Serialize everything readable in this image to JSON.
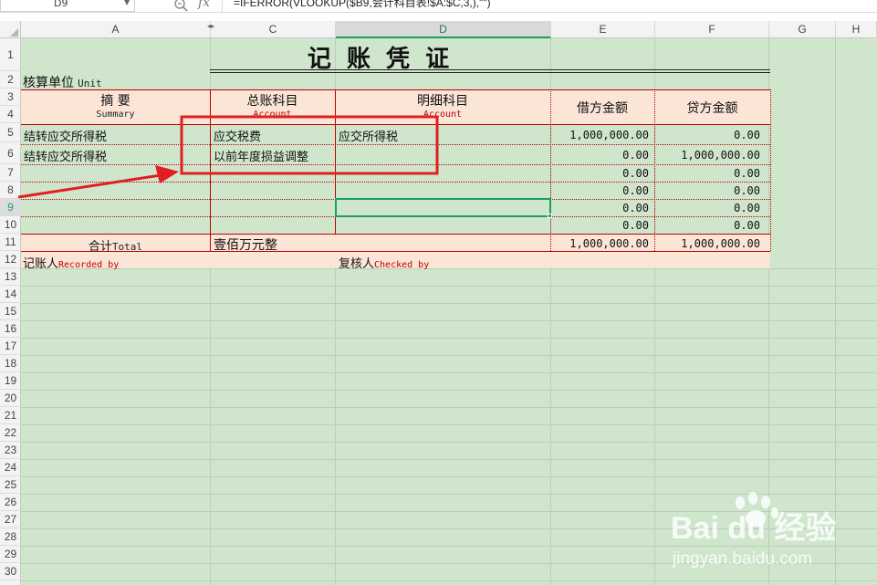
{
  "formula_bar": {
    "cell_ref": "D9",
    "formula": "=IFERROR(VLOOKUP($B9,会计科目表!$A:$C,3,),\"\")"
  },
  "columns": [
    "A",
    "C",
    "D",
    "E",
    "F",
    "G",
    "H"
  ],
  "active_column": "D",
  "rows": [
    "1",
    "2",
    "3",
    "4",
    "5",
    "6",
    "7",
    "8",
    "9",
    "10",
    "11",
    "12",
    "13",
    "14",
    "15",
    "16",
    "17",
    "18",
    "19",
    "20",
    "21",
    "22",
    "23",
    "24",
    "25",
    "26",
    "27",
    "28",
    "29",
    "30"
  ],
  "active_row": "9",
  "voucher": {
    "title": "记 账 凭 证",
    "unit_label": "核算单位",
    "unit_label_en": "Unit",
    "summary_label": "摘    要",
    "summary_label_en": "Summary",
    "account_label": "总账科目",
    "account_label_en": "Account",
    "detail_label": "明细科目",
    "detail_label_en": "Account",
    "debit_label": "借方金额",
    "credit_label": "贷方金额",
    "entries": [
      {
        "summary": "结转应交所得税",
        "account": "应交税费",
        "detail": "应交所得税",
        "debit": "1,000,000.00",
        "credit": "0.00"
      },
      {
        "summary": "结转应交所得税",
        "account": "以前年度损益调整",
        "detail": "",
        "debit": "0.00",
        "credit": "1,000,000.00"
      },
      {
        "summary": "",
        "account": "",
        "detail": "",
        "debit": "0.00",
        "credit": "0.00"
      },
      {
        "summary": "",
        "account": "",
        "detail": "",
        "debit": "0.00",
        "credit": "0.00"
      },
      {
        "summary": "",
        "account": "",
        "detail": "",
        "debit": "0.00",
        "credit": "0.00"
      },
      {
        "summary": "",
        "account": "",
        "detail": "",
        "debit": "0.00",
        "credit": "0.00"
      }
    ],
    "total_label": "合计",
    "total_label_en": "Total",
    "total_amount_text": "壹佰万元整",
    "total_debit": "1,000,000.00",
    "total_credit": "1,000,000.00",
    "recorded_label": "记账人",
    "recorded_label_en": "Recorded by",
    "checked_label": "复核人",
    "checked_label_en": "Checked by"
  },
  "watermark": {
    "brand": "Bai du 经验",
    "url": "jingyan.baidu.com"
  },
  "colors": {
    "sheet_bg": "#cfe6cc",
    "header_fill": "#fbe5d6",
    "voucher_line": "#c00000",
    "selection": "#1f9e5c",
    "annotation": "#e02020"
  }
}
